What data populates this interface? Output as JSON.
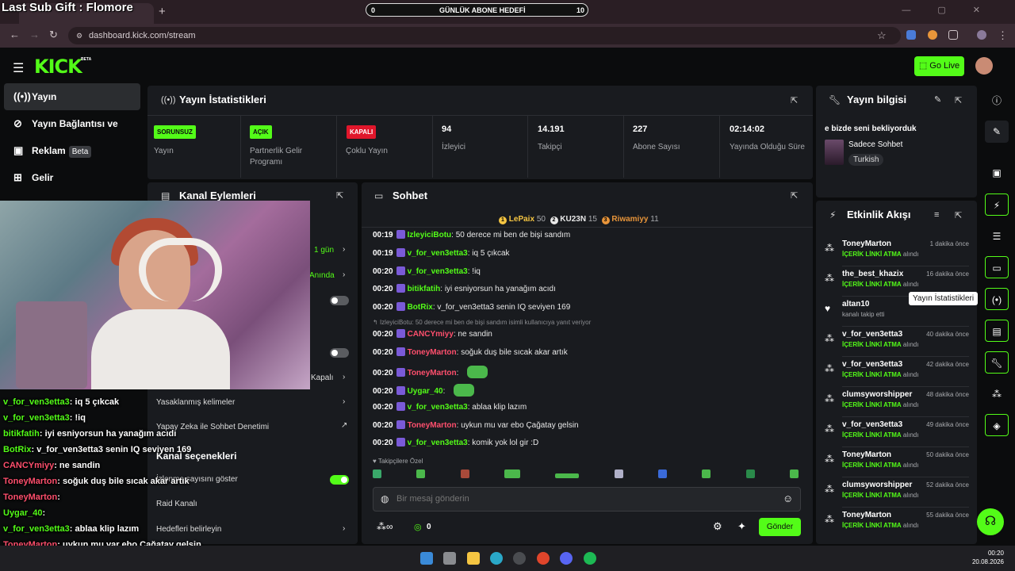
{
  "overlay": {
    "sub_gift": "Last Sub Gift : Flomore",
    "goal": {
      "min": "0",
      "label": "GÜNLÜK ABONE HEDEFİ",
      "max": "10"
    },
    "chat": [
      {
        "user": "v_for_ven3etta3",
        "text": "iq 5 çıkcak",
        "color": "#53fc18"
      },
      {
        "user": "v_for_ven3etta3",
        "text": "!iq",
        "color": "#53fc18"
      },
      {
        "user": "bitikfatih",
        "text": "iyi esniyorsun ha yanağım acıdı",
        "color": "#53fc18"
      },
      {
        "user": "BotRix",
        "text": "v_for_ven3etta3 senin IQ seviyen 169",
        "color": "#53fc18"
      },
      {
        "user": "CANCYmiyy",
        "text": "ne sandin",
        "color": "#ff4f6d"
      },
      {
        "user": "ToneyMarton",
        "text": "soğuk duş bile sıcak akar artık",
        "color": "#ff4f6d"
      },
      {
        "user": "ToneyMarton",
        "text": "",
        "color": "#ff4f6d"
      },
      {
        "user": "Uygar_40",
        "text": "",
        "color": "#53fc18"
      },
      {
        "user": "v_for_ven3etta3",
        "text": "ablaa klip lazım",
        "color": "#53fc18"
      },
      {
        "user": "ToneyMarton",
        "text": "uykun mu var ebo Çağatay gelsin",
        "color": "#ff4f6d"
      },
      {
        "user": "v_for_ven3etta3",
        "text": "komik yok lol gir :D",
        "color": "#53fc18"
      }
    ]
  },
  "browser": {
    "tab_title": "Stream - Kick Dashboard",
    "url": "dashboard.kick.com/stream"
  },
  "header": {
    "logo": "KICK",
    "beta": "BETA",
    "go_live": "Go Live"
  },
  "sidebar": {
    "items": [
      {
        "label": "Yayın",
        "icon": "broadcast-icon"
      },
      {
        "label": "Yayın Bağlantısı ve Anahtarı",
        "icon": "link-icon"
      },
      {
        "label": "Reklam",
        "icon": "ad-icon",
        "badge": "Beta"
      },
      {
        "label": "Gelir",
        "icon": "revenue-icon"
      }
    ]
  },
  "stats": {
    "title": "Yayın İstatistikleri",
    "cells": [
      {
        "badge": "SORUNSUZ",
        "label": "Yayın",
        "badge_color": "#53fc18"
      },
      {
        "badge": "AÇIK",
        "label": "Partnerlik Gelir Programı",
        "badge_color": "#53fc18"
      },
      {
        "badge": "KAPALI",
        "label": "Çoklu Yayın",
        "badge_color": "#e0162b"
      },
      {
        "value": "94",
        "label": "İzleyici"
      },
      {
        "value": "14.191",
        "label": "Takipçi"
      },
      {
        "value": "227",
        "label": "Abone Sayısı"
      },
      {
        "value": "02:14:02",
        "label": "Yayında Olduğu Süre"
      }
    ]
  },
  "info": {
    "title": "Yayın bilgisi",
    "stream_title": "e bizde seni bekliyorduk",
    "category": "Sadece Sohbet",
    "language": "Turkish"
  },
  "channel": {
    "title": "Kanal Eylemleri",
    "items": {
      "slow_value": "1 gün",
      "instant": "Anında",
      "kapali": "Kapalı",
      "banned_words": "Yasaklanmış kelimeler",
      "ai_moderation": "Yapay Zeka ile Sohbet Denetimi",
      "options_title": "Kanal seçenekleri",
      "show_viewers": "İzlenme sayısını göster",
      "raid": "Raid Kanalı",
      "goals": "Hedefleri belirleyin"
    }
  },
  "chat": {
    "title": "Sohbet",
    "leaders": [
      {
        "rank": "1",
        "name": "LePaix",
        "count": "50",
        "color": "#f5c542"
      },
      {
        "rank": "2",
        "name": "KU23N",
        "count": "15",
        "color": "#e8e8e8"
      },
      {
        "rank": "3",
        "name": "Riwamiyy",
        "count": "11",
        "color": "#e8953a"
      }
    ],
    "messages": [
      {
        "time": "00:19",
        "user": "IzleyiciBotu",
        "text": "50 derece mi ben de bişi sandım",
        "color": "#53fc18"
      },
      {
        "time": "00:19",
        "user": "v_for_ven3etta3",
        "text": "iq 5 çıkcak",
        "color": "#53fc18"
      },
      {
        "time": "00:20",
        "user": "v_for_ven3etta3",
        "text": "!iq",
        "color": "#53fc18"
      },
      {
        "time": "00:20",
        "user": "bitikfatih",
        "text": "iyi esniyorsun ha yanağım acıdı",
        "color": "#53fc18"
      },
      {
        "time": "00:20",
        "user": "BotRix",
        "text": "v_for_ven3etta3 senin IQ seviyen 169",
        "color": "#53fc18"
      },
      {
        "time": "00:20",
        "user": "CANCYmiyy",
        "text": "ne sandin",
        "color": "#ff4f6d"
      },
      {
        "time": "00:20",
        "user": "ToneyMarton",
        "text": "soğuk duş bile sıcak akar artık",
        "color": "#ff4f6d"
      },
      {
        "time": "00:20",
        "user": "ToneyMarton",
        "text": "",
        "color": "#ff4f6d"
      },
      {
        "time": "00:20",
        "user": "Uygar_40",
        "text": "",
        "color": "#53fc18"
      },
      {
        "time": "00:20",
        "user": "v_for_ven3etta3",
        "text": "ablaa klip lazım",
        "color": "#53fc18"
      },
      {
        "time": "00:20",
        "user": "ToneyMarton",
        "text": "uykun mu var ebo Çağatay gelsin",
        "color": "#ff4f6d"
      },
      {
        "time": "00:20",
        "user": "v_for_ven3etta3",
        "text": "komik yok lol gir :D",
        "color": "#53fc18"
      }
    ],
    "reply_note": "IzleyiciBotu: 50 derece mi ben de bişi sandım isimli kullanıcıya yanıt veriyor",
    "followers_only": "Takipçilere Özel",
    "input_placeholder": "Bir mesaj gönderin",
    "points": "0",
    "send": "Gönder"
  },
  "events": {
    "title": "Etkinlik Akışı",
    "items": [
      {
        "user": "ToneyMarton",
        "action": "İÇERİK LİNKİ ATMA",
        "suffix": "alındı",
        "time": "1 dakika önce",
        "icon": "redeem-icon"
      },
      {
        "user": "the_best_khazix",
        "action": "İÇERİK LİNKİ ATMA",
        "suffix": "alındı",
        "time": "16 dakika önce",
        "icon": "redeem-icon"
      },
      {
        "user": "altan10",
        "action": "",
        "suffix": "kanalı takip etti",
        "time": "",
        "icon": "heart-icon"
      },
      {
        "user": "v_for_ven3etta3",
        "action": "İÇERİK LİNKİ ATMA",
        "suffix": "alındı",
        "time": "40 dakika önce",
        "icon": "redeem-icon"
      },
      {
        "user": "v_for_ven3etta3",
        "action": "İÇERİK LİNKİ ATMA",
        "suffix": "alındı",
        "time": "42 dakika önce",
        "icon": "redeem-icon"
      },
      {
        "user": "clumsyworshipper",
        "action": "İÇERİK LİNKİ ATMA",
        "suffix": "alındı",
        "time": "48 dakika önce",
        "icon": "redeem-icon"
      },
      {
        "user": "v_for_ven3etta3",
        "action": "İÇERİK LİNKİ ATMA",
        "suffix": "alındı",
        "time": "49 dakika önce",
        "icon": "redeem-icon"
      },
      {
        "user": "ToneyMarton",
        "action": "İÇERİK LİNKİ ATMA",
        "suffix": "alındı",
        "time": "50 dakika önce",
        "icon": "redeem-icon"
      },
      {
        "user": "clumsyworshipper",
        "action": "İÇERİK LİNKİ ATMA",
        "suffix": "alındı",
        "time": "52 dakika önce",
        "icon": "redeem-icon"
      },
      {
        "user": "ToneyMarton",
        "action": "İÇERİK LİNKİ ATMA",
        "suffix": "alındı",
        "time": "55 dakika önce",
        "icon": "redeem-icon"
      }
    ]
  },
  "rail": {
    "tooltip": "Yayın İstatistikleri"
  },
  "taskbar": {
    "time": "00:20",
    "date": "20.08.2026"
  },
  "colors": {
    "accent": "#53fc18",
    "bg": "#0b0c0d",
    "panel": "#191b1f",
    "danger": "#e0162b"
  }
}
